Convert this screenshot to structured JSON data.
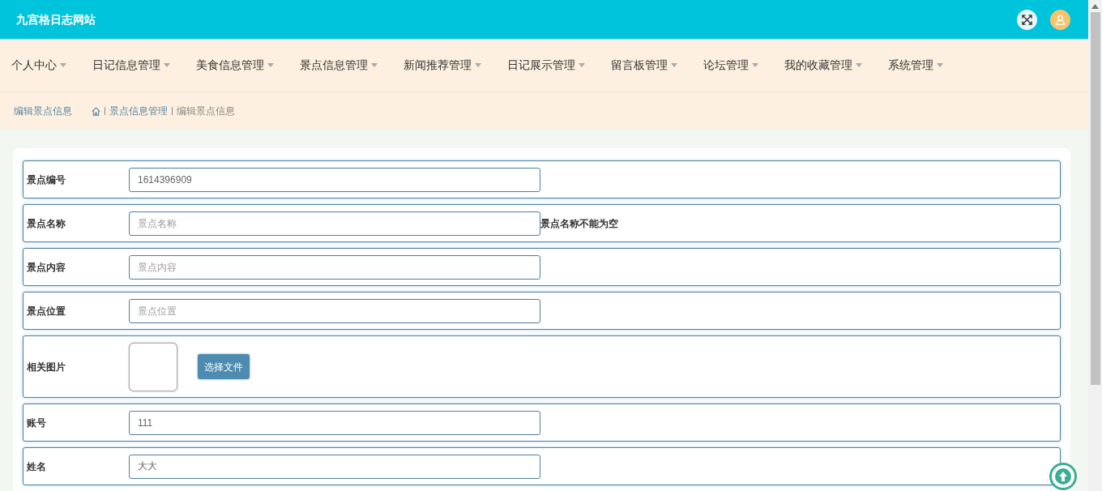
{
  "header": {
    "title": "九宫格日志网站"
  },
  "nav": [
    {
      "label": "个人中心"
    },
    {
      "label": "日记信息管理"
    },
    {
      "label": "美食信息管理"
    },
    {
      "label": "景点信息管理"
    },
    {
      "label": "新闻推荐管理"
    },
    {
      "label": "日记展示管理"
    },
    {
      "label": "留言板管理"
    },
    {
      "label": "论坛管理"
    },
    {
      "label": "我的收藏管理"
    },
    {
      "label": "系统管理"
    }
  ],
  "breadcrumb": {
    "title": "编辑景点信息",
    "path": [
      "景点信息管理",
      "编辑景点信息"
    ]
  },
  "form": [
    {
      "kind": "text",
      "label": "景点编号",
      "value": "1614396909"
    },
    {
      "kind": "text",
      "label": "景点名称",
      "placeholder": "景点名称",
      "error": "景点名称不能为空"
    },
    {
      "kind": "text",
      "label": "景点内容",
      "placeholder": "景点内容"
    },
    {
      "kind": "text",
      "label": "景点位置",
      "placeholder": "景点位置"
    },
    {
      "kind": "image",
      "label": "相关图片",
      "button": "选择文件"
    },
    {
      "kind": "text",
      "label": "账号",
      "value": "111"
    },
    {
      "kind": "text",
      "label": "姓名",
      "value": "大大"
    }
  ]
}
